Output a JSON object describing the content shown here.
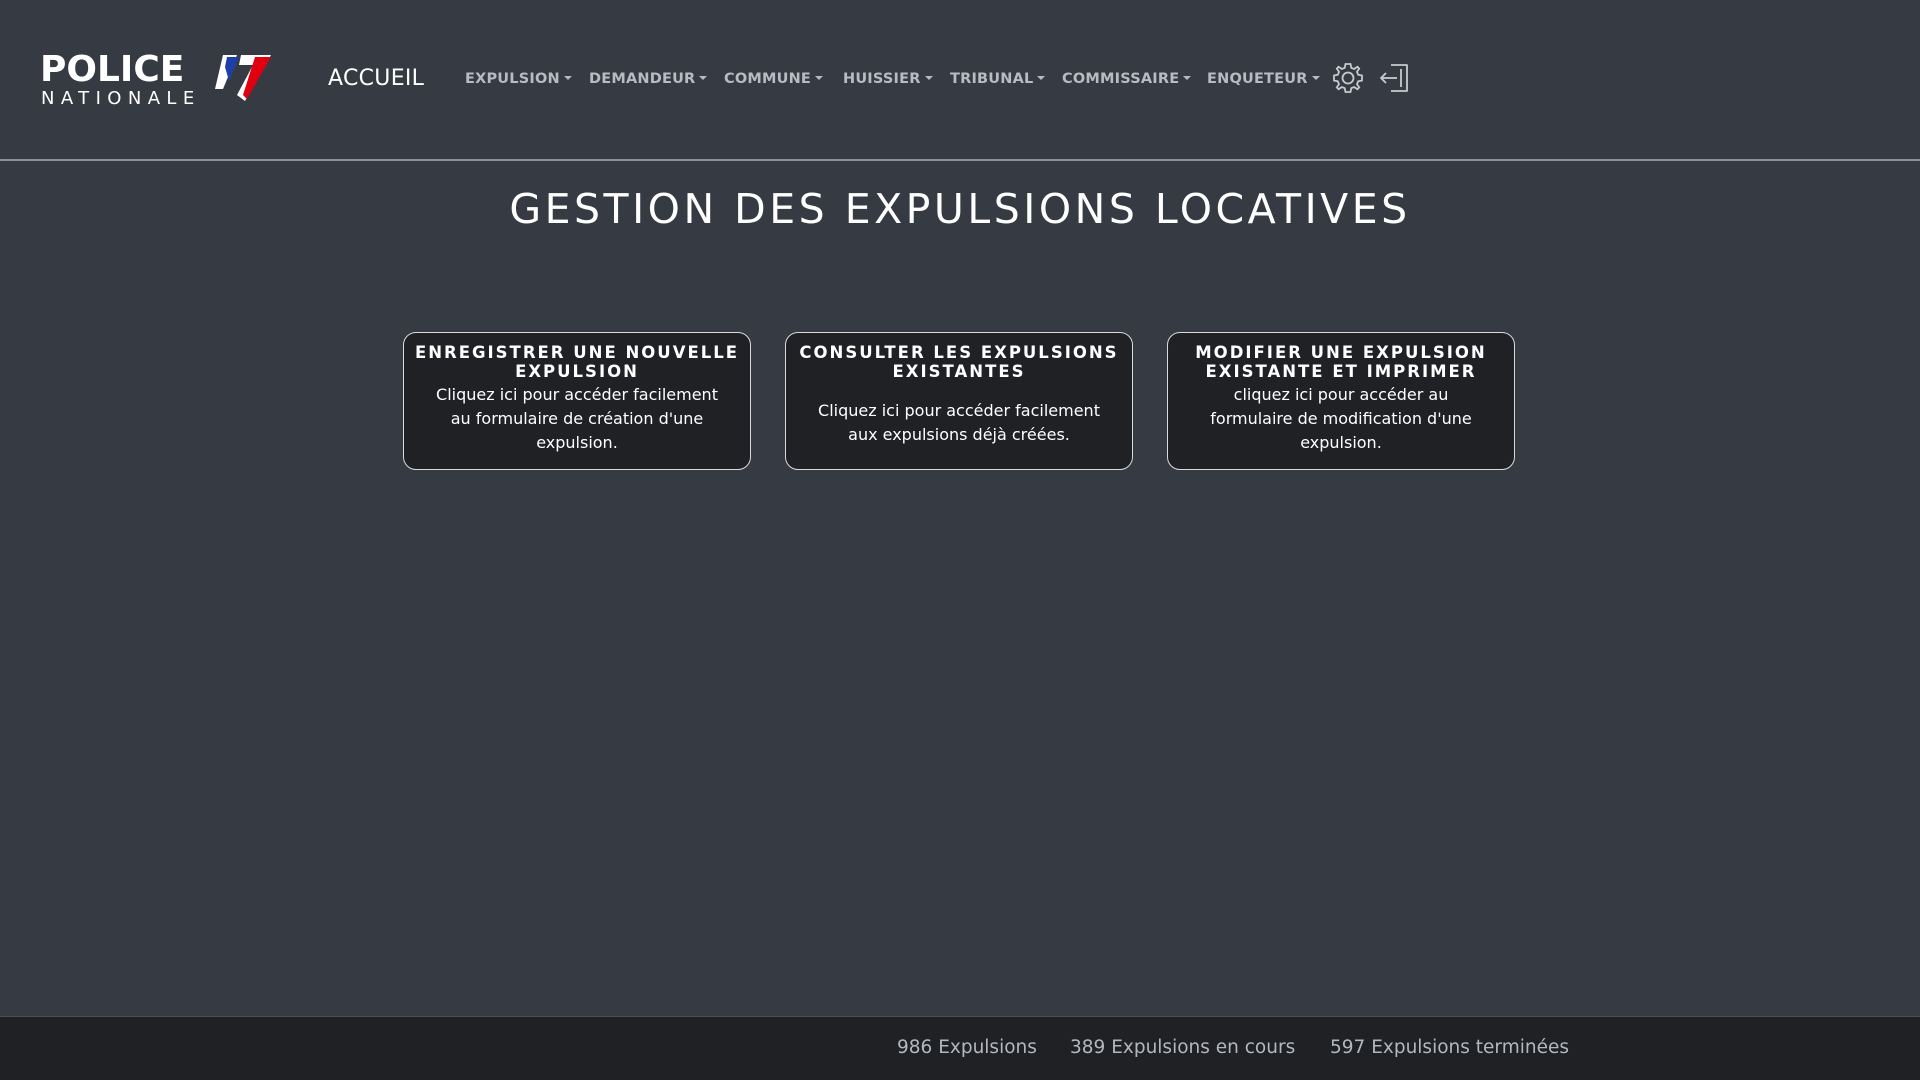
{
  "header": {
    "logo": {
      "line1": "POLICE",
      "line2": "NATIONALE"
    },
    "home_label": "ACCUEIL",
    "menus": [
      {
        "label": "EXPULSION"
      },
      {
        "label": "DEMANDEUR"
      },
      {
        "label": "COMMUNE"
      },
      {
        "label": "HUISSIER"
      },
      {
        "label": "TRIBUNAL"
      },
      {
        "label": "COMMISSAIRE"
      },
      {
        "label": "ENQUETEUR"
      }
    ],
    "icons": {
      "settings": "gear-icon",
      "logout": "logout-icon"
    }
  },
  "main": {
    "title": "GESTION DES EXPULSIONS LOCATIVES",
    "cards": [
      {
        "title_line1": "ENREGISTRER UNE NOUVELLE",
        "title_line2": "EXPULSION",
        "text_line1": "Cliquez ici pour accéder facilement",
        "text_line2": "au formulaire de création d'une",
        "text_line3": "expulsion."
      },
      {
        "title_line1": "CONSULTER LES EXPULSIONS",
        "title_line2": "EXISTANTES",
        "text_line1": "Cliquez ici pour accéder facilement",
        "text_line2": "aux expulsions déjà créées."
      },
      {
        "title_line1": "MODIFIER UNE EXPULSION",
        "title_line2": "EXISTANTE ET IMPRIMER",
        "text_line1": "cliquez ici pour accéder au",
        "text_line2": "formulaire de modification d'une",
        "text_line3": "expulsion."
      }
    ]
  },
  "footer": {
    "total": "986 Expulsions",
    "in_progress": "389 Expulsions en cours",
    "finished": "597 Expulsions terminées"
  },
  "colors": {
    "background": "#363b43",
    "card_background": "#202124",
    "footer_background": "#202124",
    "flag_blue": "#1f3fa8",
    "flag_red": "#e1000f"
  }
}
